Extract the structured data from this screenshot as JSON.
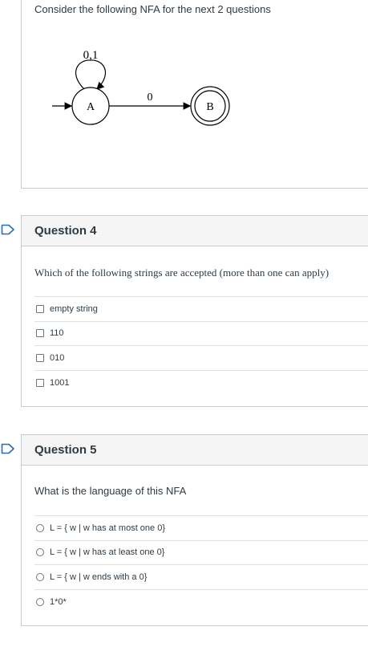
{
  "context": {
    "text": "Consider the following NFA for the next 2 questions",
    "nfa": {
      "loop_label": "0,1",
      "edge_label": "0",
      "state_a": "A",
      "state_b": "B"
    }
  },
  "question4": {
    "title": "Question 4",
    "prompt": "Which of the following strings are accepted (more than one can apply)",
    "answers": [
      "empty string",
      "110",
      "010",
      "1001"
    ]
  },
  "question5": {
    "title": "Question 5",
    "prompt": "What is the language of this NFA",
    "answers": [
      "L = { w | w has at most one 0}",
      "L = { w | w has at least one 0}",
      "L = { w | w ends with a 0}",
      "1*0*"
    ]
  },
  "colors": {
    "border": "#c7cdd1",
    "header_bg": "#f5f5f5",
    "flag_blue": "#2b6cb0",
    "text": "#2d3b45"
  },
  "icons": {
    "flag": "flag-icon",
    "checkbox": "checkbox-icon",
    "radio": "radio-icon"
  }
}
